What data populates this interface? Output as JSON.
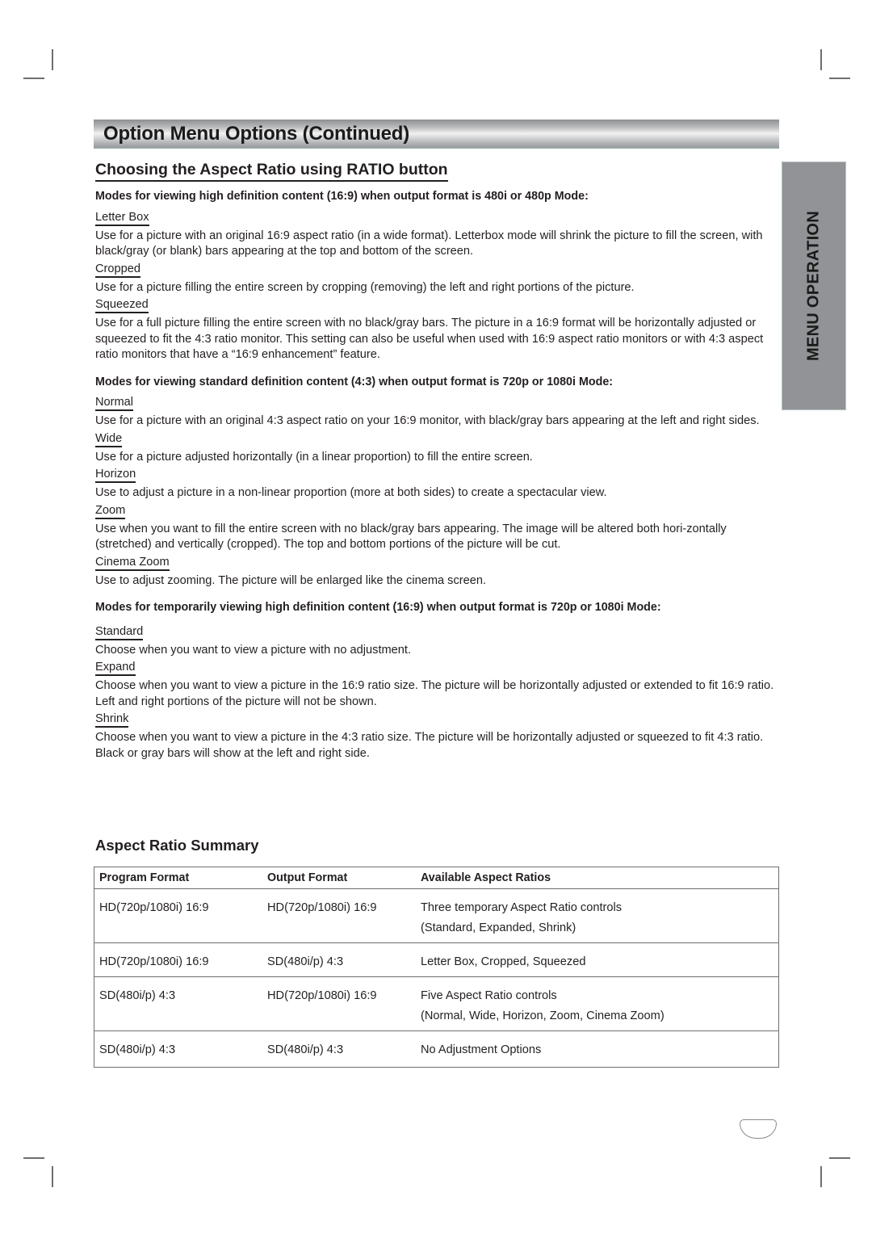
{
  "page": {
    "title": "Option Menu Options (Continued)",
    "section_heading": "Choosing the Aspect Ratio using RATIO button",
    "side_tab_label": "MENU OPERATION"
  },
  "mode_groups": [
    {
      "heading": "Modes for viewing high definition content (16:9) when output format is 480i or 480p Mode:",
      "modes": [
        {
          "name": "Letter Box",
          "description": "Use for a picture with an original 16:9 aspect ratio (in a wide format).  Letterbox mode will shrink the picture to fill the screen, with black/gray (or blank) bars appearing at the top and bottom of the screen."
        },
        {
          "name": "Cropped",
          "description": "Use for a picture filling the entire screen by cropping (removing) the left and right portions of the picture."
        },
        {
          "name": "Squeezed",
          "description": "Use for a full picture filling the entire screen with no black/gray bars.  The picture in a 16:9 format will be horizontally adjusted or squeezed to fit the 4:3 ratio monitor.  This setting can also be useful when used with 16:9 aspect ratio monitors or with 4:3 aspect ratio monitors that have a “16:9 enhancement” feature."
        }
      ]
    },
    {
      "heading": "Modes for viewing standard definition content (4:3) when output format is 720p or 1080i Mode:",
      "modes": [
        {
          "name": "Normal",
          "description": "Use for a picture with an original 4:3 aspect ratio on your 16:9 monitor, with black/gray bars appearing at the left and right sides."
        },
        {
          "name": "Wide",
          "description": "Use for a picture adjusted horizontally (in a linear proportion) to fill the entire screen."
        },
        {
          "name": "Horizon",
          "description": "Use to adjust a picture in a non-linear proportion (more at both sides) to create a spectacular view."
        },
        {
          "name": "Zoom",
          "description": "Use when you want to fill the entire screen with no black/gray bars appearing.  The image will be altered both hori-zontally (stretched) and vertically (cropped).  The top and bottom portions of the picture will be cut."
        },
        {
          "name": "Cinema Zoom",
          "description": "Use to adjust zooming. The picture will be enlarged like the cinema screen."
        }
      ]
    },
    {
      "heading": "Modes for temporarily viewing high definition content (16:9) when output format is 720p or 1080i Mode:",
      "modes": [
        {
          "name": "Standard",
          "description": "Choose when you want to view a picture with no adjustment."
        },
        {
          "name": "Expand",
          "description": "Choose when you want to view a picture in the 16:9 ratio size. The picture will be horizontally adjusted or extended to fit 16:9 ratio. Left and right portions of the picture will not be shown."
        },
        {
          "name": "Shrink",
          "description": "Choose when you want to view a picture in the 4:3 ratio size. The picture will be horizontally adjusted or squeezed to fit 4:3 ratio. Black or gray bars will show at the left and right side."
        }
      ]
    }
  ],
  "summary": {
    "heading": "Aspect Ratio Summary",
    "columns": [
      "Program Format",
      "Output Format",
      "Available Aspect Ratios"
    ],
    "rows": [
      {
        "program": "HD(720p/1080i) 16:9",
        "output": "HD(720p/1080i) 16:9",
        "ratios": "Three temporary Aspect Ratio controls",
        "ratios_detail": "(Standard, Expanded, Shrink)"
      },
      {
        "program": "HD(720p/1080i) 16:9",
        "output": "SD(480i/p) 4:3",
        "ratios": "Letter Box, Cropped, Squeezed",
        "ratios_detail": ""
      },
      {
        "program": "SD(480i/p) 4:3",
        "output": "HD(720p/1080i) 16:9",
        "ratios": "Five Aspect Ratio controls",
        "ratios_detail": "(Normal, Wide, Horizon, Zoom, Cinema Zoom)"
      },
      {
        "program": "SD(480i/p) 4:3",
        "output": "SD(480i/p) 4:3",
        "ratios": "No Adjustment Options",
        "ratios_detail": ""
      }
    ]
  }
}
